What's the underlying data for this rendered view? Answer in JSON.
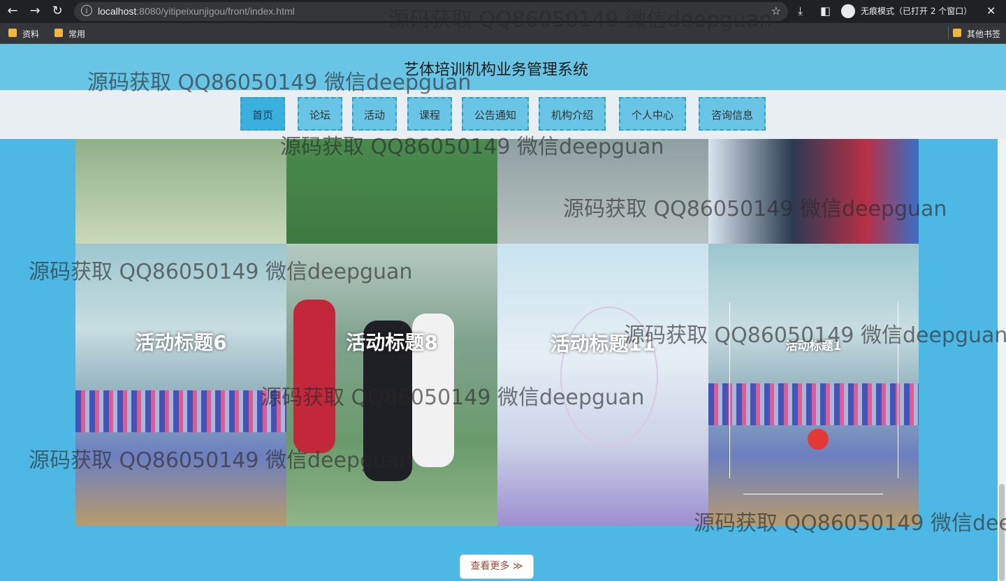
{
  "browser": {
    "url_host": "localhost",
    "url_port": ":8080",
    "url_path": "/yitipeixunjigou/front/index.html",
    "incognito": "无痕模式（已打开 2 个窗口）",
    "bookmarks": [
      "资料",
      "常用"
    ],
    "other_bookmarks": "其他书签"
  },
  "site": {
    "title": "艺体培训机构业务管理系统",
    "nav": [
      "首页",
      "论坛",
      "活动",
      "课程",
      "公告通知",
      "机构介绍",
      "个人中心",
      "咨询信息"
    ],
    "active_nav": "首页"
  },
  "gallery": {
    "labels": [
      "活动标题6",
      "活动标题8",
      "活动标题11",
      "活动标题1"
    ]
  },
  "more_button": "查看更多 ≫",
  "watermark": "源码获取 QQ86050149 微信deepguan",
  "watermark_cut": "源码获取 QQ86050149 微信dee"
}
